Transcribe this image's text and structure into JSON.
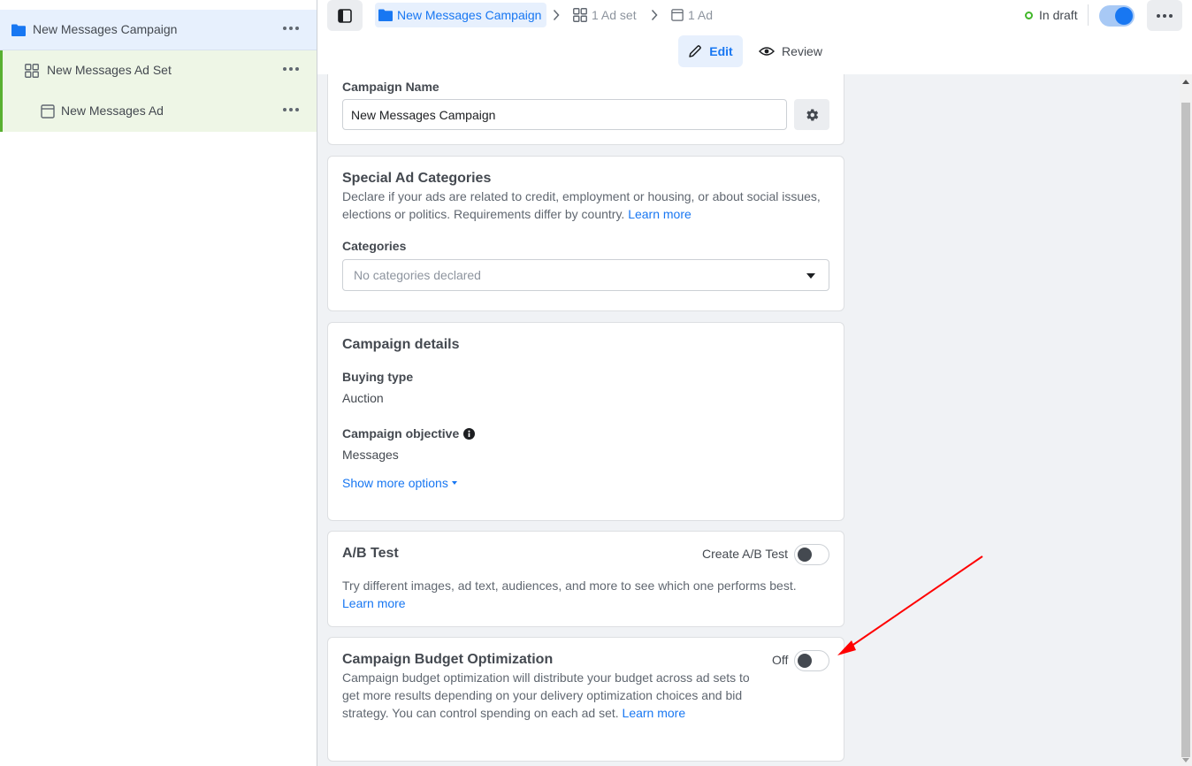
{
  "sidebar": {
    "items": [
      {
        "label": "New Messages Campaign",
        "icon": "folder-icon"
      },
      {
        "label": "New Messages Ad Set",
        "icon": "grid-icon"
      },
      {
        "label": "New Messages Ad",
        "icon": "ad-icon"
      }
    ]
  },
  "header": {
    "breadcrumb": {
      "campaign": "New Messages Campaign",
      "ad_set": "1 Ad set",
      "ad": "1 Ad"
    },
    "status": "In draft",
    "campaign_enabled": true,
    "tabs": {
      "edit": "Edit",
      "review": "Review"
    }
  },
  "campaign_name": {
    "label": "Campaign Name",
    "value": "New Messages Campaign"
  },
  "special_ad_categories": {
    "title": "Special Ad Categories",
    "description": "Declare if your ads are related to credit, employment or housing, or about social issues, elections or politics. Requirements differ by country.",
    "learn_more": "Learn more",
    "categories_label": "Categories",
    "categories_placeholder": "No categories declared"
  },
  "campaign_details": {
    "title": "Campaign details",
    "buying_type_label": "Buying type",
    "buying_type_value": "Auction",
    "objective_label": "Campaign objective",
    "objective_value": "Messages",
    "show_more": "Show more options"
  },
  "ab_test": {
    "title": "A/B Test",
    "toggle_label": "Create A/B Test",
    "enabled": false,
    "description": "Try different images, ad text, audiences, and more to see which one performs best.",
    "learn_more": "Learn more"
  },
  "cbo": {
    "title": "Campaign Budget Optimization",
    "toggle_label": "Off",
    "enabled": false,
    "description": "Campaign budget optimization will distribute your budget across ad sets to get more results depending on your delivery optimization choices and bid strategy. You can control spending on each ad set.",
    "learn_more": "Learn more"
  },
  "colors": {
    "accent": "#1877f2",
    "selected_bg": "#e7f0fd",
    "child_bg": "#eef6e6",
    "child_border": "#58b030",
    "draft_status": "#42b72a",
    "annotation": "#ff0000"
  }
}
